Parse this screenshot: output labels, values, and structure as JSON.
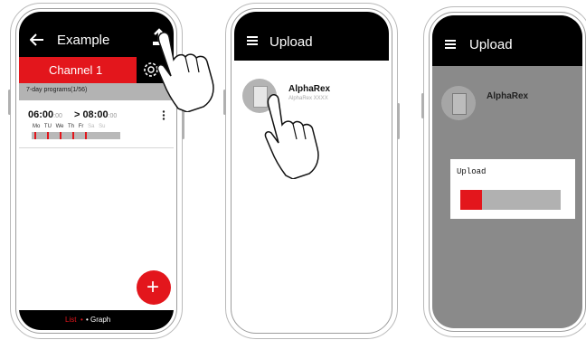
{
  "phone1": {
    "title": "Example",
    "channel_tab": "Channel 1",
    "programs_label": "7-day programs(1/56)",
    "program": {
      "start": "06:00",
      "start_sec": ":00",
      "arrow": ">",
      "end": "08:00",
      "end_sec": ":00",
      "days": [
        "Mo",
        "TU",
        "We",
        "Th",
        "Fr",
        "Sa",
        "Su"
      ],
      "days_active": [
        true,
        true,
        true,
        true,
        true,
        false,
        false
      ]
    },
    "fab_label": "+",
    "footer": {
      "list": "List",
      "sep": "•",
      "graph": "• Graph"
    }
  },
  "phone2": {
    "title": "Upload",
    "device_name": "AlphaRex",
    "device_model": "AlphaRex XXXX"
  },
  "phone3": {
    "title": "Upload",
    "device_name": "AlphaRex",
    "dialog_title": "Upload",
    "progress": 0.22
  },
  "colors": {
    "accent": "#e3161c",
    "dark": "#000000",
    "overlay": "#8a8a8a"
  },
  "icons": [
    "back-arrow-icon",
    "upload-icon",
    "gear-icon",
    "more-vert-icon",
    "menu-icon",
    "plus-icon",
    "hand-pointer-icon"
  ]
}
